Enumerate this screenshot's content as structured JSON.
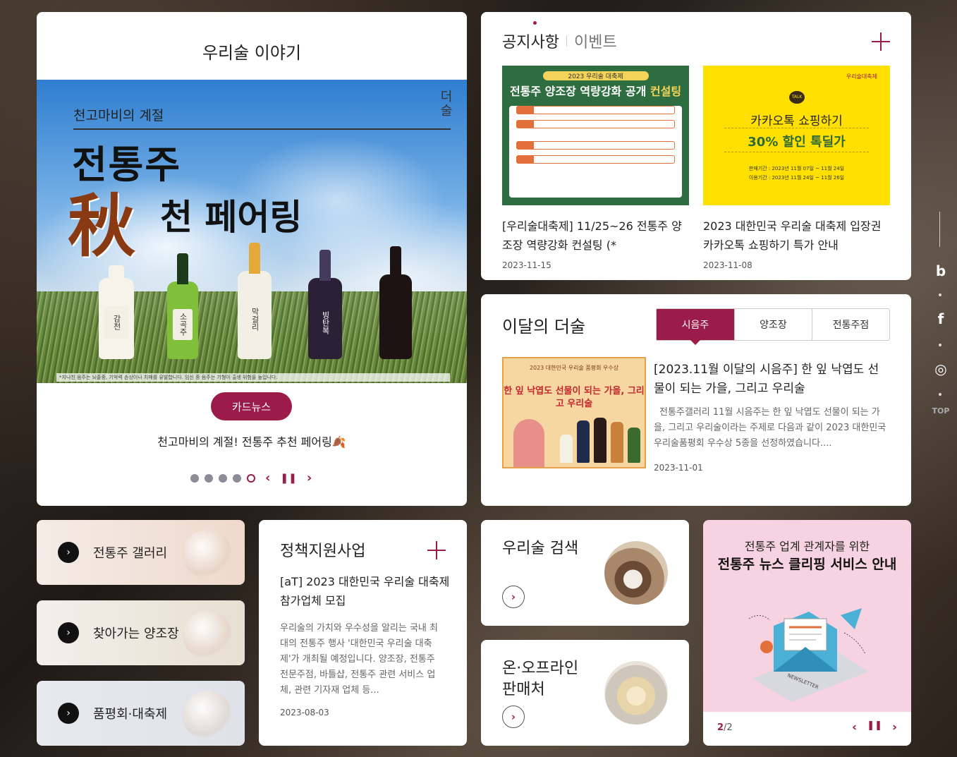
{
  "story": {
    "title": "우리술 이야기",
    "banner": {
      "subtitle": "천고마비의 계절",
      "headline1": "전통주",
      "autumn_char": "秋",
      "headline2": "천 페어링",
      "logo": "더술",
      "disclaimer": "*지나친 음주는 뇌졸중, 기억력 손상이나 치매를 유발합니다. 임신 중 음주는 기형아 출생 위험을 높입니다.",
      "bottle_labels": [
        "감천",
        "소곡주",
        "막걸리",
        "빙탄복",
        ""
      ]
    },
    "tag": "카드뉴스",
    "caption": "천고마비의 계절! 전통주 추천 페어링🍂",
    "pager": {
      "total": 5,
      "active": 5
    }
  },
  "notice": {
    "tab_active": "공지사항",
    "tab_other": "이벤트",
    "items": [
      {
        "title": "[우리술대축제] 11/25~26 전통주 양조장 역량강화 컨설팅 (*",
        "date": "2023-11-15",
        "thumb_top": "2023 우리술 대축제",
        "thumb_big_a": "전통주 양조장 역량강화 공개",
        "thumb_big_b": "컨설팅"
      },
      {
        "title": "2023 대한민국 우리술 대축제 입장권 카카오톡 쇼핑하기 특가 안내",
        "date": "2023-11-08",
        "thumb_talk": "TALK",
        "thumb_l1": "카카오톡 쇼핑하기",
        "thumb_l2": "30% 할인 톡딜가",
        "thumb_l3a": "판매기간 : 2023년 11월 07일 ~ 11월 24일",
        "thumb_l3b": "이용기간 : 2023년 11월 24일 ~ 11월 26일",
        "thumb_brand": "우리술대축제"
      }
    ]
  },
  "monthly": {
    "title": "이달의 더술",
    "tabs": [
      "시음주",
      "양조장",
      "전통주점"
    ],
    "active_tab": 0,
    "thumb_t1": "2023 대한민국 우리술 품평회 우수상",
    "thumb_t2": "한 잎 낙엽도 선물이 되는 가을, 그리고 우리술",
    "heading": "[2023.11월 이달의 시음주] 한 잎 낙엽도 선물이 되는 가을, 그리고 우리술",
    "desc": "전통주갤러리 11월 시음주는 한 잎 낙엽도 선물이 되는 가을, 그리고 우리술이라는 주제로 다음과 같이 2023 대한민국 우리술품평회 우수상 5종을 선정하였습니다....",
    "date": "2023-11-01"
  },
  "quick_links": [
    {
      "label": "전통주 갤러리"
    },
    {
      "label": "찾아가는 양조장"
    },
    {
      "label": "품평회·대축제"
    }
  ],
  "policy": {
    "title": "정책지원사업",
    "heading": "[aT] 2023 대한민국 우리술 대축제 참가업체 모집",
    "desc": "우리술의 가치와 우수성을 알리는 국내 최대의 전통주 행사 '대한민국 우리술 대축제'가 개최될 예정입니다. 양조장, 전통주 전문주점, 바틀샵, 전통주 관련 서비스 업체, 관련 기자재 업체 등...",
    "date": "2023-08-03"
  },
  "search": {
    "title": "우리술 검색"
  },
  "shops": {
    "title": "온·오프라인 판매처"
  },
  "newsletter": {
    "line1": "전통주 업계 관계자를 위한",
    "line2": "전통주 뉴스 클리핑 서비스 안내",
    "label": "NEWSLETTER",
    "page_current": "2",
    "page_total": "/2"
  },
  "side": {
    "top_label": "TOP"
  },
  "colors": {
    "brand": "#9b1b49"
  }
}
